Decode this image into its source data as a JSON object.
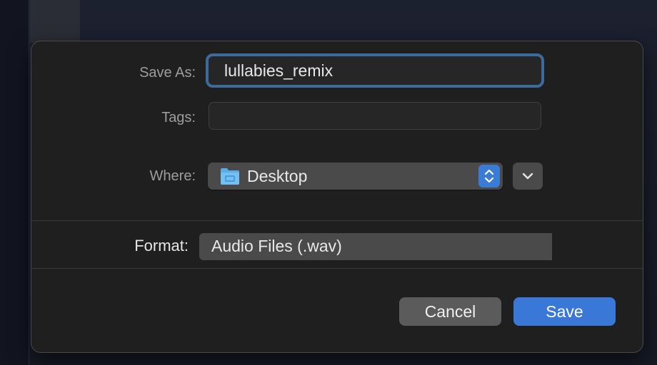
{
  "dialog": {
    "save_as_label": "Save As:",
    "save_as_value": "lullabies_remix",
    "tags_label": "Tags:",
    "tags_value": "",
    "where_label": "Where:",
    "where_value": "Desktop",
    "format_label": "Format:",
    "format_value": "Audio Files (.wav)",
    "cancel_label": "Cancel",
    "save_label": "Save"
  },
  "icons": {
    "where_folder": "folder-icon",
    "where_stepper": "up-down-chevron-icon",
    "expand": "chevron-down-icon"
  },
  "colors": {
    "accent": "#3a78d8",
    "focus_ring": "#3c6a9d",
    "sheet_bg": "#1f1f1f",
    "control_bg": "#4a4a4a"
  }
}
